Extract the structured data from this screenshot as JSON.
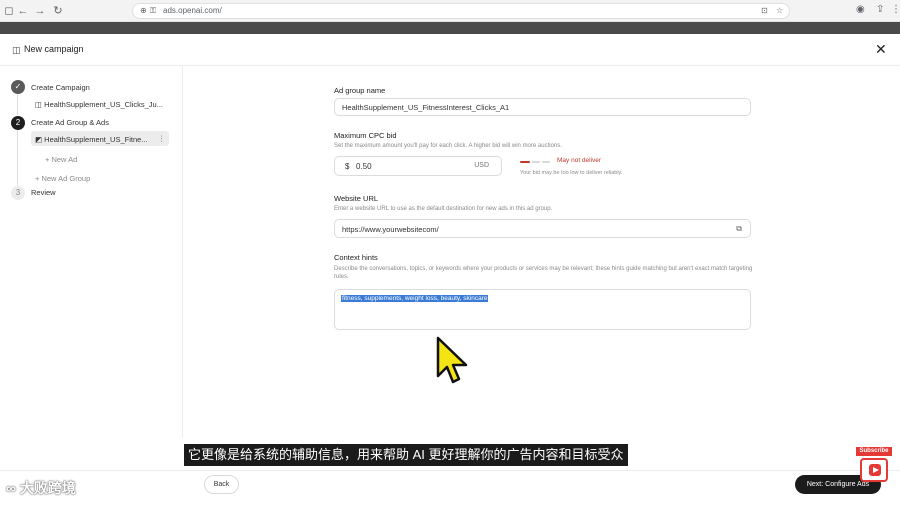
{
  "browser": {
    "url": "ads.openai.com/"
  },
  "header": {
    "title": "New campaign"
  },
  "sidebar": {
    "steps": [
      {
        "number": "✓",
        "label": "Create Campaign",
        "sub": "HealthSupplement_US_Clicks_Ju..."
      },
      {
        "number": "2",
        "label": "Create Ad Group & Ads",
        "sub": "HealthSupplement_US_Fitne...",
        "add_ad": "+ New Ad",
        "add_group": "+ New Ad Group"
      },
      {
        "number": "3",
        "label": "Review"
      }
    ]
  },
  "form": {
    "ad_group_name": {
      "label": "Ad group name",
      "value": "HealthSupplement_US_FitnessInterest_Clicks_A1"
    },
    "max_cpc": {
      "label": "Maximum CPC bid",
      "help": "Set the maximum amount you'll pay for each click. A higher bid will win more auctions.",
      "symbol": "$",
      "value": "0.50",
      "currency": "USD",
      "warning_title": "May not deliver",
      "warning_text": "Your bid may be too low to deliver reliably."
    },
    "website_url": {
      "label": "Website URL",
      "help": "Enter a website URL to use as the default destination for new ads in this ad group.",
      "value": "https://www.yourwebsitecom/"
    },
    "context_hints": {
      "label": "Context hints",
      "help": "Describe the conversations, topics, or keywords where your products or services may be relevant; these hints guide matching but aren't exact match targeting rules.",
      "value": "fitness, supplements, weight loss, beauty, skincare"
    }
  },
  "footer": {
    "back": "Back",
    "next": "Next: Configure Ads"
  },
  "subtitle": "它更像是给系统的辅助信息，用来帮助 AI 更好理解你的广告内容和目标受众",
  "watermark": "大败跨境",
  "subscribe": "Subscribe",
  "colors": {
    "warning": "#c0392b",
    "selection": "#3a7bd5",
    "primary_button": "#1b1b1b"
  }
}
